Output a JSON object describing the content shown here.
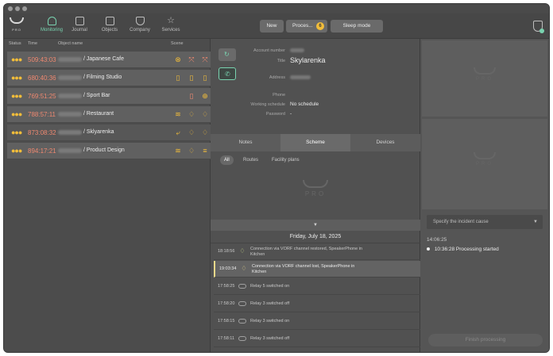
{
  "app": {
    "logo_text": "PRO"
  },
  "nav": [
    {
      "label": "Monitoring",
      "icon": "bell-icon",
      "active": true
    },
    {
      "label": "Journal",
      "icon": "journal-icon"
    },
    {
      "label": "Objects",
      "icon": "house-icon"
    },
    {
      "label": "Company",
      "icon": "shield-icon"
    },
    {
      "label": "Services",
      "icon": "star-icon"
    }
  ],
  "toolbar": {
    "new_label": "New",
    "processing_label": "Proces...",
    "processing_count": "6",
    "sleep_label": "Sleep mode"
  },
  "list": {
    "headers": {
      "status": "Status",
      "time": "Time",
      "object": "Object name",
      "scene": "Scene"
    },
    "rows": [
      {
        "time": "509:43:03",
        "name": "/ Japanese Cafe",
        "icons": [
          "⊗",
          "⤧",
          "⤧"
        ]
      },
      {
        "time": "680:40:36",
        "name": "/ Filming Studio",
        "icons": [
          "▯",
          "▯",
          "▯"
        ]
      },
      {
        "time": "769:51:25",
        "name": "/ Sport Bar",
        "icons": [
          "▯",
          "⊕"
        ]
      },
      {
        "time": "788:57:11",
        "name": "/ Restaurant",
        "icons": [
          "≋",
          "♢",
          "♢"
        ]
      },
      {
        "time": "873:08:32",
        "name": "/ Sklyarenka",
        "icons": [
          "⤶",
          "♢",
          "♢"
        ],
        "selected": true
      },
      {
        "time": "894:17:21",
        "name": "/ Product Design",
        "icons": [
          "≋",
          "♢",
          "≡"
        ]
      }
    ]
  },
  "object": {
    "account_label": "Account number",
    "title_label": "Title",
    "title": "Skylarenka",
    "address_label": "Address",
    "phone_label": "Phone",
    "schedule_label": "Working schedule",
    "schedule_value": "No schedule",
    "password_label": "Password",
    "password_value": "-"
  },
  "tabs": {
    "notes": "Notes",
    "scheme": "Scheme",
    "devices": "Devices"
  },
  "subtabs": {
    "all": "All",
    "routes": "Routes",
    "facility": "Facility plans"
  },
  "watermark": "PRO",
  "events": {
    "date": "Friday, July 18, 2025",
    "items": [
      {
        "time": "18:18:56",
        "line1": "Connection via VORF channel restored, SpeakerPhone in",
        "line2": "Kitchen"
      },
      {
        "time": "19:03:34",
        "line1": "Connection via VORF channel lost, SpeakerPhone in",
        "line2": "Kitchen"
      },
      {
        "time": "17:58:25",
        "line1": "Relay 5 switched on",
        "line2": ""
      },
      {
        "time": "17:58:20",
        "line1": "Relay 3 switched off",
        "line2": ""
      },
      {
        "time": "17:58:15",
        "line1": "Relay 3 switched on",
        "line2": ""
      },
      {
        "time": "17:58:11",
        "line1": "Relay 3 switched off",
        "line2": ""
      }
    ]
  },
  "incident": {
    "select_placeholder": "Specify the incident cause",
    "history_time": "14:06:25",
    "history_item": "10:36:28 Processing started",
    "finish_label": "Finish processing"
  }
}
